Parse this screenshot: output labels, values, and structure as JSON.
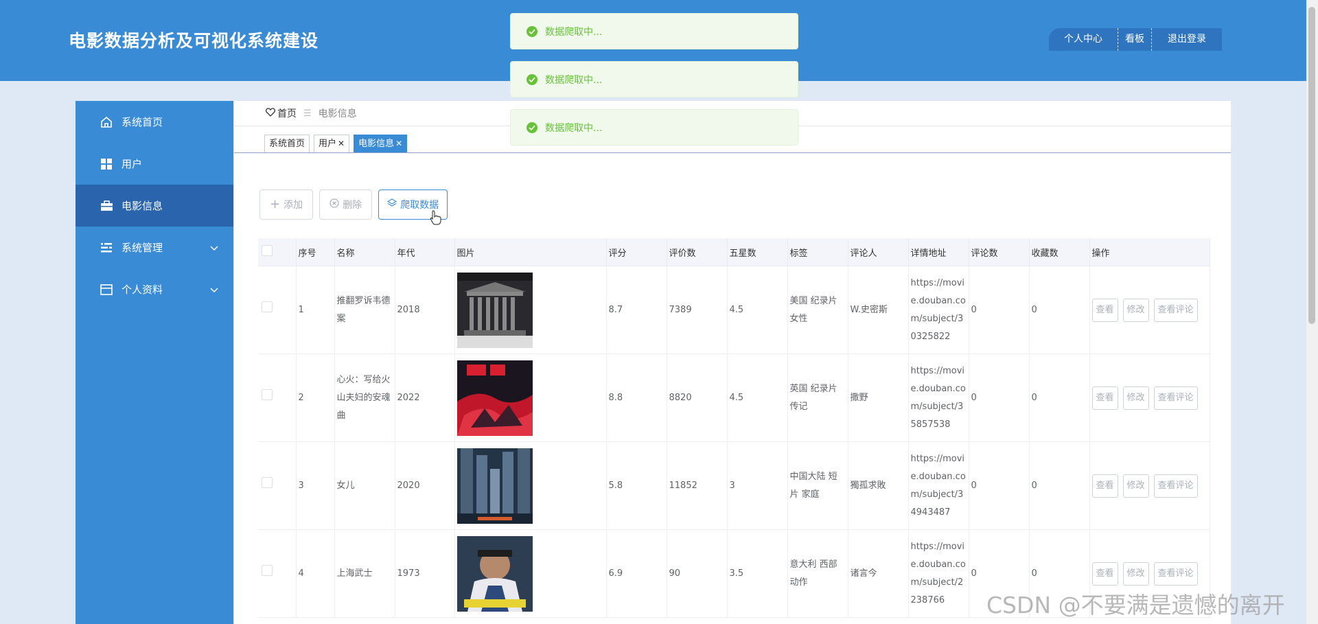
{
  "header": {
    "app_title": "电影数据分析及可视化系统建设",
    "nav": [
      "个人中心",
      "看板",
      "退出登录"
    ]
  },
  "toasts": [
    "数据爬取中...",
    "数据爬取中...",
    "数据爬取中..."
  ],
  "sidebar": {
    "items": [
      {
        "label": "系统首页",
        "icon": "home-icon"
      },
      {
        "label": "用户",
        "icon": "grid-icon"
      },
      {
        "label": "电影信息",
        "icon": "briefcase-icon",
        "active": true
      },
      {
        "label": "系统管理",
        "icon": "menu-lines-icon",
        "expandable": true
      },
      {
        "label": "个人资料",
        "icon": "card-icon",
        "expandable": true
      }
    ]
  },
  "breadcrumb": {
    "home": "首页",
    "current": "电影信息"
  },
  "tabs": [
    {
      "label": "系统首页",
      "closable": false
    },
    {
      "label": "用户",
      "closable": true
    },
    {
      "label": "电影信息",
      "closable": true,
      "active": true
    }
  ],
  "toolbar": {
    "add": "添加",
    "delete": "删除",
    "crawl": "爬取数据"
  },
  "table": {
    "headers": [
      "序号",
      "名称",
      "年代",
      "图片",
      "评分",
      "评价数",
      "五星数",
      "标签",
      "评论人",
      "详情地址",
      "评论数",
      "收藏数",
      "操作"
    ],
    "actions": [
      "查看",
      "修改",
      "查看评论"
    ],
    "rows": [
      {
        "no": "1",
        "name": "推翻罗诉韦德案",
        "year": "2018",
        "rating": "8.7",
        "votes": "7389",
        "stars": "4.5",
        "tags": "美国 纪录片 女性",
        "reviewer": "W.史密斯",
        "url": "https://movie.douban.com/subject/30325822",
        "comments": "0",
        "favorites": "0"
      },
      {
        "no": "2",
        "name": "心火：写给火山夫妇的安魂曲",
        "year": "2022",
        "rating": "8.8",
        "votes": "8820",
        "stars": "4.5",
        "tags": "英国 纪录片 传记",
        "reviewer": "撒野",
        "url": "https://movie.douban.com/subject/35857538",
        "comments": "0",
        "favorites": "0"
      },
      {
        "no": "3",
        "name": "女儿",
        "year": "2020",
        "rating": "5.8",
        "votes": "11852",
        "stars": "3",
        "tags": "中国大陆 短片 家庭",
        "reviewer": "獨孤求敗",
        "url": "https://movie.douban.com/subject/34943487",
        "comments": "0",
        "favorites": "0"
      },
      {
        "no": "4",
        "name": "上海武士",
        "year": "1973",
        "rating": "6.9",
        "votes": "90",
        "stars": "3.5",
        "tags": "意大利 西部 动作",
        "reviewer": "诸言今",
        "url": "https://movie.douban.com/subject/2238766",
        "comments": "0",
        "favorites": "0"
      }
    ]
  },
  "watermark": "CSDN @不要满是遗憾的离开"
}
